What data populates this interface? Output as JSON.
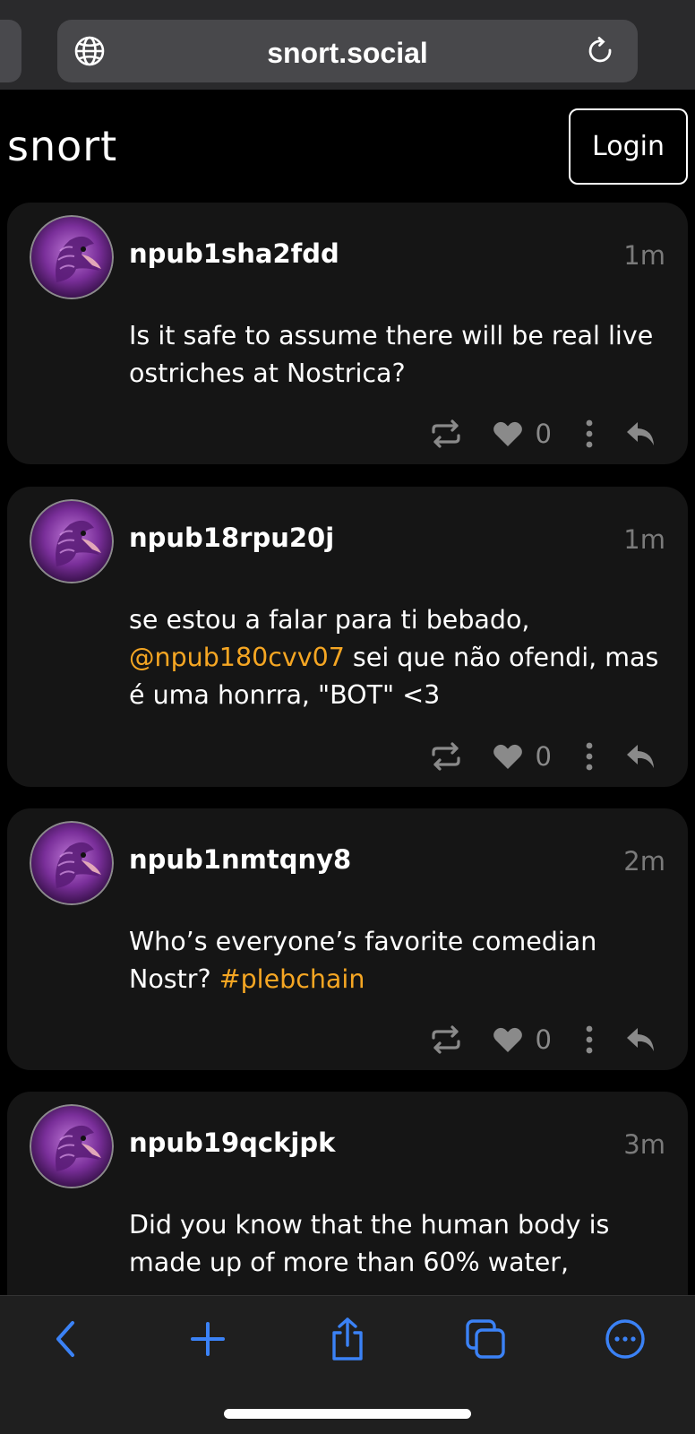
{
  "browser": {
    "url": "snort.social",
    "icons": {
      "globe": "globe-icon",
      "reload": "reload-icon"
    }
  },
  "app": {
    "logo": "snort",
    "login_label": "Login"
  },
  "notes": [
    {
      "author": "npub1sha2fdd",
      "time": "1m",
      "text_parts": [
        {
          "t": "Is it safe to assume there will be real live ostriches at Nostrica?"
        }
      ],
      "likes": "0"
    },
    {
      "author": "npub18rpu20j",
      "time": "1m",
      "text_parts": [
        {
          "t": "se estou a falar para ti bebado, "
        },
        {
          "t": "@npub180cvv07",
          "kind": "mention"
        },
        {
          "t": " sei que não ofendi, mas é uma honrra, \"BOT\" <3"
        }
      ],
      "likes": "0"
    },
    {
      "author": "npub1nmtqny8",
      "time": "2m",
      "text_parts": [
        {
          "t": "Who’s everyone’s favorite comedian Nostr? "
        },
        {
          "t": "#plebchain",
          "kind": "hashtag"
        }
      ],
      "likes": "0"
    },
    {
      "author": "npub19qckjpk",
      "time": "3m",
      "text_parts": [
        {
          "t": "Did you know that the human body is made up of more than 60% water,"
        }
      ],
      "likes": ""
    }
  ],
  "toolbar": {
    "icons": [
      "back-icon",
      "new-tab-plus-icon",
      "share-icon",
      "tabs-icon",
      "more-icon"
    ]
  },
  "colors": {
    "accent": "#f5a623",
    "toolbar_icon": "#3b82f6",
    "card_bg": "#151515"
  }
}
